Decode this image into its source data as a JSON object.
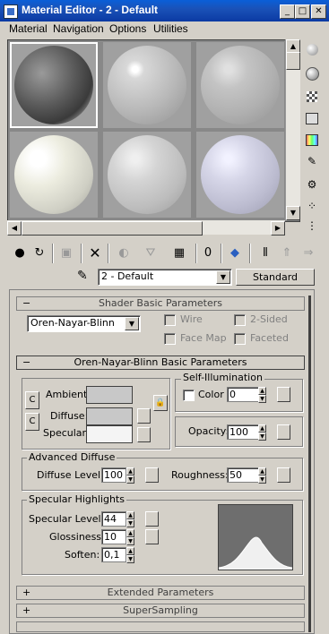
{
  "window": {
    "title": "Material Editor - 2 - Default",
    "minimize_glyph": "_",
    "maximize_glyph": "□",
    "close_glyph": "✕"
  },
  "menu": {
    "items": [
      "Material",
      "Navigation",
      "Options",
      "Utilities"
    ]
  },
  "slots": [
    {
      "index": 1,
      "active": true,
      "color": "#7a7a7a"
    },
    {
      "index": 2,
      "active": false,
      "color": "#c8c8c8"
    },
    {
      "index": 3,
      "active": false,
      "color": "#c0c0c0"
    },
    {
      "index": 4,
      "active": false,
      "color": "#e6e6dc"
    },
    {
      "index": 5,
      "active": false,
      "color": "#d0d0d0"
    },
    {
      "index": 6,
      "active": false,
      "color": "#cfcfe0"
    }
  ],
  "toolbar": {
    "material_name": "2 - Default",
    "material_type": "Standard"
  },
  "shader_rollout": {
    "title": "Shader Basic Parameters",
    "collapse_glyph": "−",
    "shader": "Oren-Nayar-Blinn",
    "wire": "Wire",
    "two_sided": "2-Sided",
    "face_map": "Face Map",
    "faceted": "Faceted"
  },
  "basic_rollout": {
    "title": "Oren-Nayar-Blinn Basic Parameters",
    "collapse_glyph": "−",
    "ambient_label": "Ambient:",
    "diffuse_label": "Diffuse:",
    "specular_label": "Specular:",
    "self_illum_group": "Self-Illumination",
    "color_label": "Color",
    "color_value": "0",
    "opacity_label": "Opacity:",
    "opacity_value": "100",
    "adv_diffuse_group": "Advanced Diffuse",
    "diffuse_level_label": "Diffuse Level:",
    "diffuse_level_value": "100",
    "roughness_label": "Roughness:",
    "roughness_value": "50",
    "spec_group": "Specular Highlights",
    "spec_level_label": "Specular Level:",
    "spec_level_value": "44",
    "glossiness_label": "Glossiness:",
    "glossiness_value": "10",
    "soften_label": "Soften:",
    "soften_value": "0,1"
  },
  "collapsed_rollouts": [
    {
      "title": "Extended Parameters",
      "expand_glyph": "+"
    },
    {
      "title": "SuperSampling",
      "expand_glyph": "+"
    }
  ],
  "colors": {
    "ambient": "#c8c8c8",
    "diffuse": "#c8c8c8",
    "specular": "#f4f4f4",
    "titlebar": "#0b4fc8"
  }
}
